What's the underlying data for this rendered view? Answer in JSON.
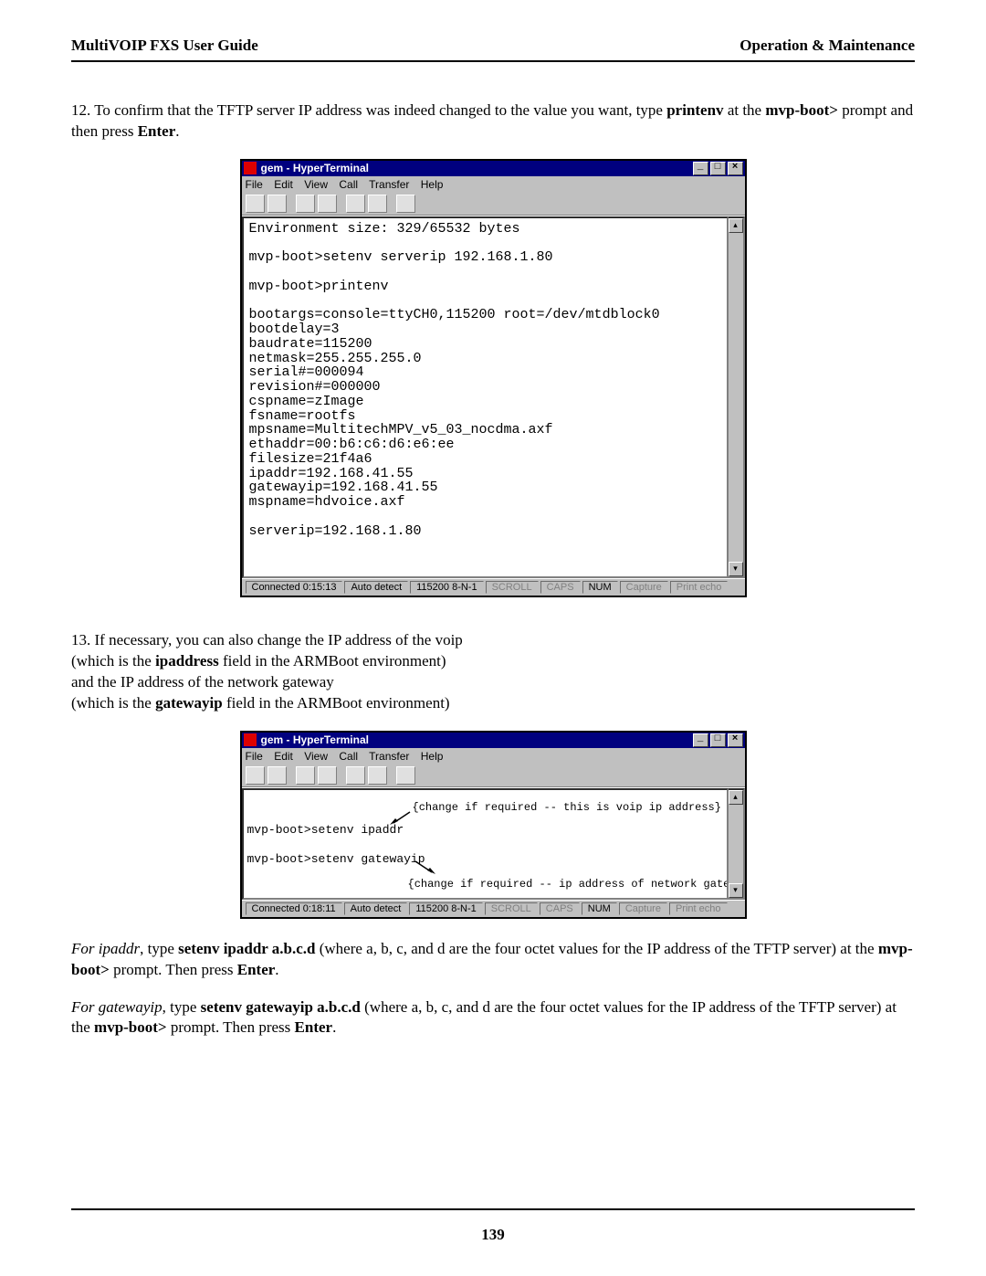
{
  "header": {
    "left": "MultiVOIP FXS User Guide",
    "right": "Operation & Maintenance"
  },
  "step12": {
    "prefix": "12. To confirm that the TFTP server IP address was indeed changed to the value you want,  type  ",
    "cmd": "printenv",
    "mid": "  at the ",
    "prompt": "mvp-boot>",
    "tail1": " prompt and then press ",
    "enter": "Enter",
    "tail2": "."
  },
  "term1": {
    "title": "gem - HyperTerminal",
    "menu": [
      "File",
      "Edit",
      "View",
      "Call",
      "Transfer",
      "Help"
    ],
    "content": "Environment size: 329/65532 bytes\n\nmvp-boot>setenv serverip 192.168.1.80\n\nmvp-boot>printenv\n\nbootargs=console=ttyCH0,115200 root=/dev/mtdblock0\nbootdelay=3\nbaudrate=115200\nnetmask=255.255.255.0\nserial#=000094\nrevision#=000000\ncspname=zImage\nfsname=rootfs\nmpsname=MultitechMPV_v5_03_nocdma.axf\nethaddr=00:b6:c6:d6:e6:ee\nfilesize=21f4a6\nipaddr=192.168.41.55\ngatewayip=192.168.41.55\nmspname=hdvoice.axf\n\nserverip=192.168.1.80\n\n",
    "status": {
      "time": "Connected 0:15:13",
      "detect": "Auto detect",
      "conn": "115200 8-N-1",
      "scroll": "SCROLL",
      "caps": "CAPS",
      "num": "NUM",
      "capture": "Capture",
      "print": "Print echo"
    }
  },
  "step13": {
    "l1": "13. If necessary, you can also change the IP address of the voip",
    "l2a": "(which is the ",
    "l2b": "ipaddress",
    "l2c": " field in the ARMBoot environment)",
    "l3": "and the IP address of the network gateway",
    "l4a": "(which is the ",
    "l4b": "gatewayip",
    "l4c": " field in the ARMBoot environment)"
  },
  "term2": {
    "title": "gem - HyperTerminal",
    "menu": [
      "File",
      "Edit",
      "View",
      "Call",
      "Transfer",
      "Help"
    ],
    "line1": "mvp-boot>setenv ipaddr",
    "annot1": "{change if required -- this is voip ip address}",
    "line2": "mvp-boot>setenv gatewayip",
    "annot2": "{change if required -- ip address of network gateway}",
    "status": {
      "time": "Connected 0:18:11",
      "detect": "Auto detect",
      "conn": "115200 8-N-1",
      "scroll": "SCROLL",
      "caps": "CAPS",
      "num": "NUM",
      "capture": "Capture",
      "print": "Print echo"
    }
  },
  "ipaddr_note": {
    "p1a": "For ipaddr",
    "p1b": ", type  ",
    "p1c": "setenv ipaddr a.b.c.d",
    "p1d": "  (where a, b, c, and d are the four octet values for the IP address of the TFTP server) at the ",
    "p1e": "mvp-boot>",
    "p1f": " prompt.  Then press ",
    "p1g": "Enter",
    "p1h": "."
  },
  "gateway_note": {
    "p1a": "For gatewayip",
    "p1b": ", type  ",
    "p1c": "setenv gatewayip a.b.c.d",
    "p1d": "  (where a, b, c, and d are the four octet values for the IP address of the TFTP server) at the ",
    "p1e": "mvp-boot>",
    "p1f": " prompt.  Then press ",
    "p1g": "Enter",
    "p1h": "."
  },
  "page_number": "139"
}
